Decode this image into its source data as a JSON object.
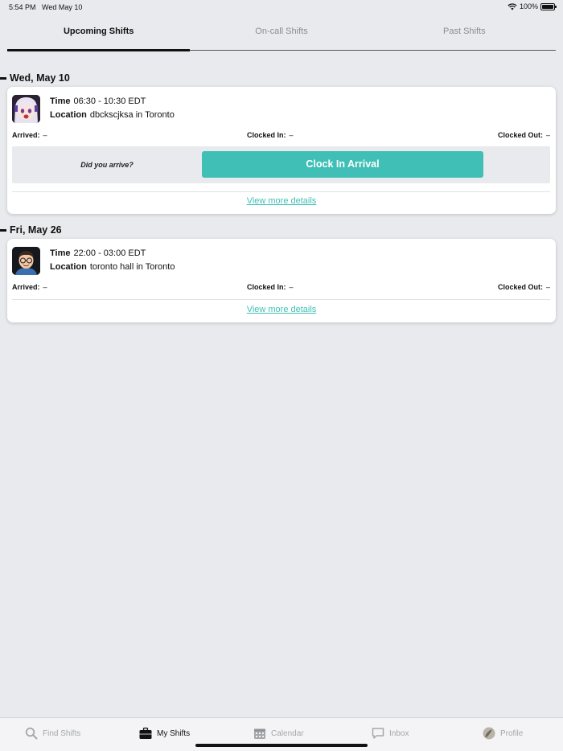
{
  "status_bar": {
    "time": "5:54 PM",
    "date": "Wed May 10",
    "battery": "100%"
  },
  "tabs": [
    {
      "label": "Upcoming Shifts",
      "active": true
    },
    {
      "label": "On-call Shifts",
      "active": false
    },
    {
      "label": "Past Shifts",
      "active": false
    }
  ],
  "shifts": [
    {
      "date": "Wed, May 10",
      "time_label": "Time",
      "time": "06:30 - 10:30 EDT",
      "location_label": "Location",
      "location": "dbckscjksa in Toronto",
      "arrived_label": "Arrived:",
      "arrived": "–",
      "clocked_in_label": "Clocked In:",
      "clocked_in": "–",
      "clocked_out_label": "Clocked Out:",
      "clocked_out": "–",
      "arrive_question": "Did you arrive?",
      "clock_in_button": "Clock In Arrival",
      "details_link": "View more details"
    },
    {
      "date": "Fri, May 26",
      "time_label": "Time",
      "time": "22:00 - 03:00 EDT",
      "location_label": "Location",
      "location": "toronto hall  in Toronto",
      "arrived_label": "Arrived:",
      "arrived": "–",
      "clocked_in_label": "Clocked In:",
      "clocked_in": "–",
      "clocked_out_label": "Clocked Out:",
      "clocked_out": "–",
      "details_link": "View more details"
    }
  ],
  "tabbar": [
    {
      "label": "Find Shifts",
      "icon": "search-icon",
      "active": false
    },
    {
      "label": "My Shifts",
      "icon": "briefcase-icon",
      "active": true
    },
    {
      "label": "Calendar",
      "icon": "calendar-icon",
      "active": false
    },
    {
      "label": "Inbox",
      "icon": "chat-icon",
      "active": false
    },
    {
      "label": "Profile",
      "icon": "profile-avatar-icon",
      "active": false
    }
  ],
  "colors": {
    "accent": "#3fbfb5",
    "background": "#e9eaed"
  }
}
